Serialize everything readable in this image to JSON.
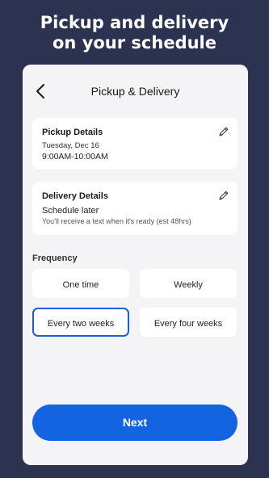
{
  "headline": {
    "line1": "Pickup and delivery",
    "line2": "on your schedule"
  },
  "nav": {
    "title": "Pickup & Delivery",
    "back_icon": "chevron-left-icon"
  },
  "pickup": {
    "title": "Pickup Details",
    "date": "Tuesday, Dec 16",
    "time": "9:00AM-10:00AM",
    "edit_icon": "pencil-icon"
  },
  "delivery": {
    "title": "Delivery Details",
    "status": "Schedule later",
    "note": "You'll receive a text when it's ready (est 48hrs)",
    "edit_icon": "pencil-icon"
  },
  "frequency": {
    "label": "Frequency",
    "options": [
      {
        "label": "One time",
        "selected": false
      },
      {
        "label": "Weekly",
        "selected": false
      },
      {
        "label": "Every two weeks",
        "selected": true
      },
      {
        "label": "Every four weeks",
        "selected": false
      }
    ]
  },
  "next_button": {
    "label": "Next"
  },
  "colors": {
    "background": "#2c3350",
    "accent": "#1463e0",
    "selected_border": "#1a5fd6"
  }
}
